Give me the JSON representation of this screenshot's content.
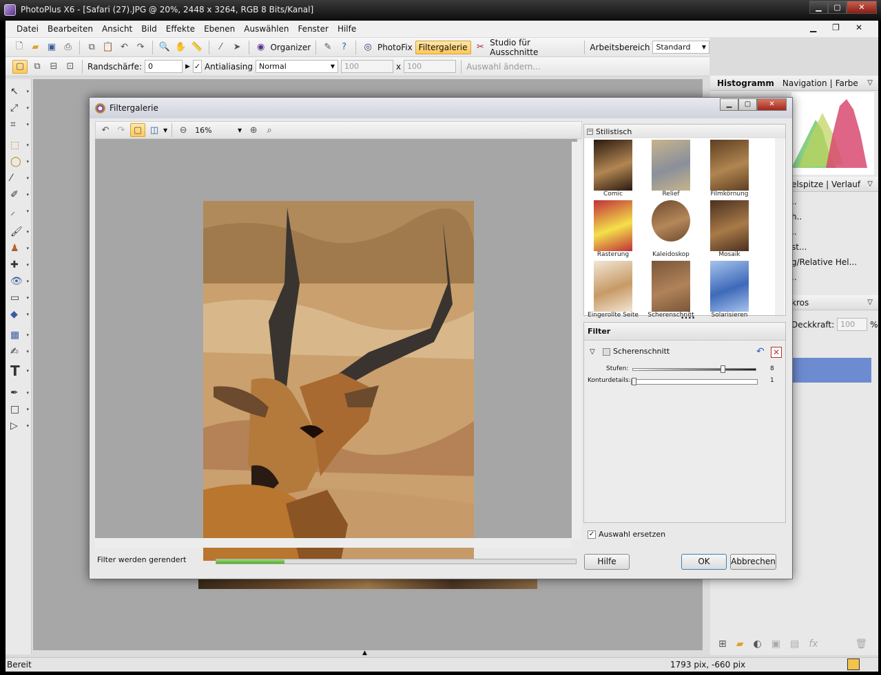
{
  "window": {
    "title": "PhotoPlus X6 - [Safari (27).JPG @ 20%, 2448 x 3264, RGB 8 Bits/Kanal]"
  },
  "menu": [
    "Datei",
    "Bearbeiten",
    "Ansicht",
    "Bild",
    "Effekte",
    "Ebenen",
    "Auswählen",
    "Fenster",
    "Hilfe"
  ],
  "toolbar": {
    "organizer": "Organizer",
    "photofix": "PhotoFix",
    "filtergalerie": "Filtergalerie",
    "studio": "Studio für Ausschnitte",
    "arbeitsbereich_label": "Arbeitsbereich",
    "arbeitsbereich_value": "Standard"
  },
  "options_bar": {
    "randschaerfe_label": "Randschärfe:",
    "randschaerfe_value": "0",
    "antialiasing": "Antialiasing",
    "mode": "Normal",
    "width": "100",
    "x": "x",
    "height": "100",
    "auswahl_button": "Auswahl ändern..."
  },
  "right_panels": {
    "tab_histogram": "Histogramm",
    "tab_navigation": "Navigation",
    "tab_farbe": "Farbe",
    "panel2_tabs": "elspitze | Verlauf",
    "panel2_items": [
      "..",
      "h..",
      "..",
      "st...",
      "g/Relative Hel...",
      ".."
    ],
    "panel3_title": "kros",
    "deckkraft_label": "Deckkraft:",
    "deckkraft_value": "100",
    "percent": "%"
  },
  "status": {
    "left": "Bereit",
    "coords": "1793 pix, -660 pix"
  },
  "dialog": {
    "title": "Filtergalerie",
    "zoom": "16%",
    "gallery_category": "Stilistisch",
    "thumbs": [
      {
        "label": "Comic",
        "colors": [
          "#b38652",
          "#2a1a10"
        ]
      },
      {
        "label": "Relief",
        "colors": [
          "#8a8f9a",
          "#c7b48d"
        ]
      },
      {
        "label": "Filmkörnung",
        "colors": [
          "#b08550",
          "#5e3f22"
        ]
      },
      {
        "label": "Rasterung",
        "colors": [
          "#f4e04a",
          "#c0303a"
        ]
      },
      {
        "label": "Kaleidoskop",
        "colors": [
          "#b5875a",
          "#6b4a2e"
        ]
      },
      {
        "label": "Mosaik",
        "colors": [
          "#a87a48",
          "#4a3020"
        ]
      },
      {
        "label": "Eingerollte Seite",
        "colors": [
          "#c79a66",
          "#f2e6d4"
        ]
      },
      {
        "label": "Scherenschnitt",
        "colors": [
          "#b0825a",
          "#7a5638"
        ]
      },
      {
        "label": "Solarisieren",
        "colors": [
          "#3e6ab8",
          "#a7c2ee"
        ]
      }
    ],
    "filter_header": "Filter",
    "filter_name": "Scherenschnitt",
    "param1_label": "Stufen:",
    "param1_value": "8",
    "param1_level": 0.74,
    "param2_label": "Konturdetails:",
    "param2_value": "1",
    "param2_level": 0.0,
    "replace_selection": "Auswahl ersetzen",
    "status_text": "Filter werden gerendert",
    "progress": 0.19,
    "help": "Hilfe",
    "ok": "OK",
    "cancel": "Abbrechen"
  }
}
